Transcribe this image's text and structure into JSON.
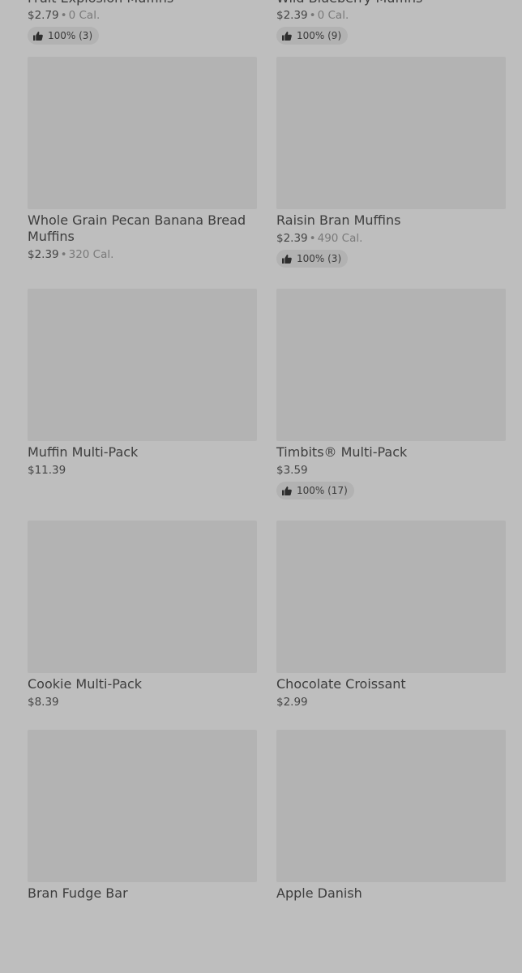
{
  "products": [
    {
      "name": "Fruit Explosion Muffins",
      "price": "$2.79",
      "cal": "0 Cal.",
      "rating": "100% (3)"
    },
    {
      "name": "Wild Blueberry Muffins",
      "price": "$2.39",
      "cal": "0 Cal.",
      "rating": "100% (9)"
    },
    {
      "name": "Whole Grain Pecan Banana Bread Muffins",
      "price": "$2.39",
      "cal": "320 Cal.",
      "rating": ""
    },
    {
      "name": "Raisin Bran Muffins",
      "price": "$2.39",
      "cal": "490 Cal.",
      "rating": "100% (3)"
    },
    {
      "name": "Muffin Multi-Pack",
      "price": "$11.39",
      "cal": "",
      "rating": ""
    },
    {
      "name": "Timbits® Multi-Pack",
      "price": "$3.59",
      "cal": "",
      "rating": "100% (17)"
    },
    {
      "name": "Cookie Multi-Pack",
      "price": "$8.39",
      "cal": "",
      "rating": ""
    },
    {
      "name": "Chocolate Croissant",
      "price": "$2.99",
      "cal": "",
      "rating": ""
    },
    {
      "name": "Bran Fudge Bar",
      "price": "",
      "cal": "",
      "rating": ""
    },
    {
      "name": "Apple Danish",
      "price": "",
      "cal": "",
      "rating": ""
    }
  ],
  "colors": {
    "background": "#bebebe",
    "image_placeholder": "#b3b3b3",
    "rating_pill": "#b2b2b2"
  },
  "icons": {
    "rating": "thumbs-up-icon"
  }
}
